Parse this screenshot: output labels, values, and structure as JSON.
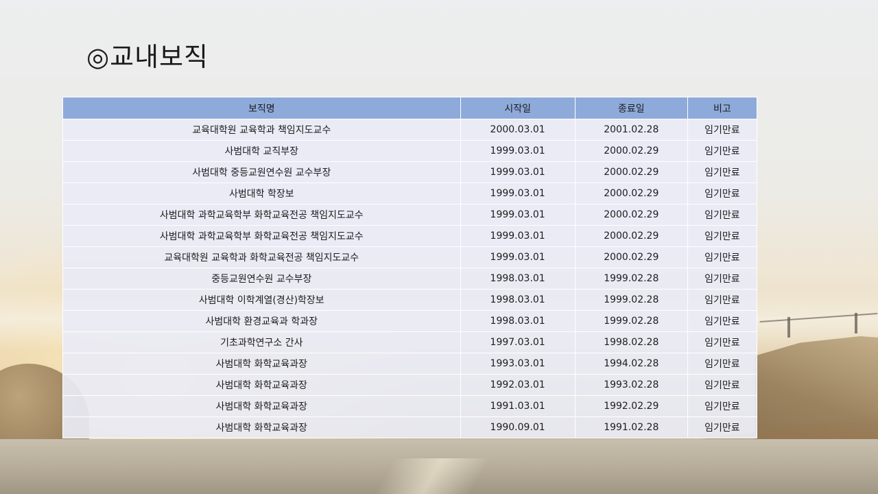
{
  "slide": {
    "title": "◎교내보직"
  },
  "table": {
    "headers": {
      "position": "보직명",
      "start": "시작일",
      "end": "종료일",
      "note": "비고"
    },
    "rows": [
      {
        "position": "교육대학원 교육학과 책임지도교수",
        "start": "2000.03.01",
        "end": "2001.02.28",
        "note": "임기만료"
      },
      {
        "position": "사범대학 교직부장",
        "start": "1999.03.01",
        "end": "2000.02.29",
        "note": "임기만료"
      },
      {
        "position": "사범대학 중등교원연수원 교수부장",
        "start": "1999.03.01",
        "end": "2000.02.29",
        "note": "임기만료"
      },
      {
        "position": "사범대학 학장보",
        "start": "1999.03.01",
        "end": "2000.02.29",
        "note": "임기만료"
      },
      {
        "position": "사범대학 과학교육학부 화학교육전공 책임지도교수",
        "start": "1999.03.01",
        "end": "2000.02.29",
        "note": "임기만료"
      },
      {
        "position": "사범대학 과학교육학부 화학교육전공 책임지도교수",
        "start": "1999.03.01",
        "end": "2000.02.29",
        "note": "임기만료"
      },
      {
        "position": "교육대학원 교육학과 화학교육전공 책임지도교수",
        "start": "1999.03.01",
        "end": "2000.02.29",
        "note": "임기만료"
      },
      {
        "position": "중등교원연수원 교수부장",
        "start": "1998.03.01",
        "end": "1999.02.28",
        "note": "임기만료"
      },
      {
        "position": "사범대학 이학계열(경산)학장보",
        "start": "1998.03.01",
        "end": "1999.02.28",
        "note": "임기만료"
      },
      {
        "position": "사범대학 환경교육과 학과장",
        "start": "1998.03.01",
        "end": "1999.02.28",
        "note": "임기만료"
      },
      {
        "position": "기초과학연구소 간사",
        "start": "1997.03.01",
        "end": "1998.02.28",
        "note": "임기만료"
      },
      {
        "position": "사범대학 화학교육과장",
        "start": "1993.03.01",
        "end": "1994.02.28",
        "note": "임기만료"
      },
      {
        "position": "사범대학 화학교육과장",
        "start": "1992.03.01",
        "end": "1993.02.28",
        "note": "임기만료"
      },
      {
        "position": "사범대학 화학교육과장",
        "start": "1991.03.01",
        "end": "1992.02.29",
        "note": "임기만료"
      },
      {
        "position": "사범대학 화학교육과장",
        "start": "1990.09.01",
        "end": "1991.02.28",
        "note": "임기만료"
      }
    ]
  },
  "colors": {
    "header_fill": "#8eaadb",
    "row_fill": "#e9ebf5"
  }
}
